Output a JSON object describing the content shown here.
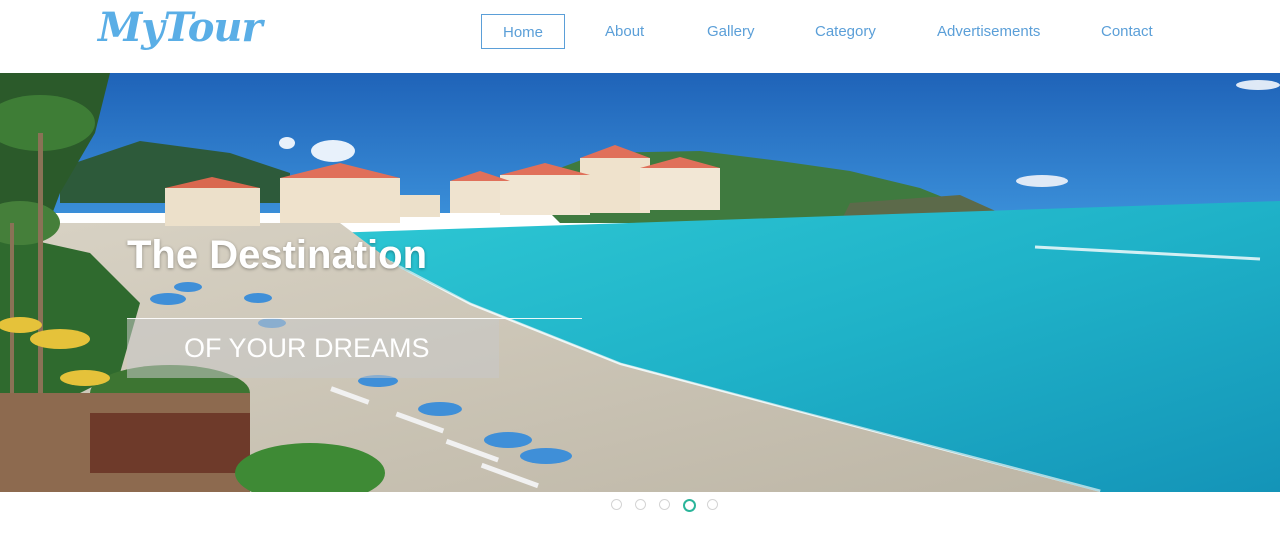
{
  "brand": {
    "logo_text": "MyTour",
    "logo_color": "#5aaee6"
  },
  "nav": {
    "items": [
      {
        "label": "Home",
        "active": true
      },
      {
        "label": "About",
        "active": false
      },
      {
        "label": "Gallery",
        "active": false
      },
      {
        "label": "Category",
        "active": false
      },
      {
        "label": "Advertisements",
        "active": false
      },
      {
        "label": "Contact",
        "active": false
      }
    ],
    "link_color": "#5b9fd8"
  },
  "hero": {
    "title": "The Destination",
    "subtitle": "OF YOUR DREAMS",
    "image": "beach-resort-photo"
  },
  "slider": {
    "slide_count": 5,
    "active_index": 3,
    "active_color": "#2bb59a"
  }
}
